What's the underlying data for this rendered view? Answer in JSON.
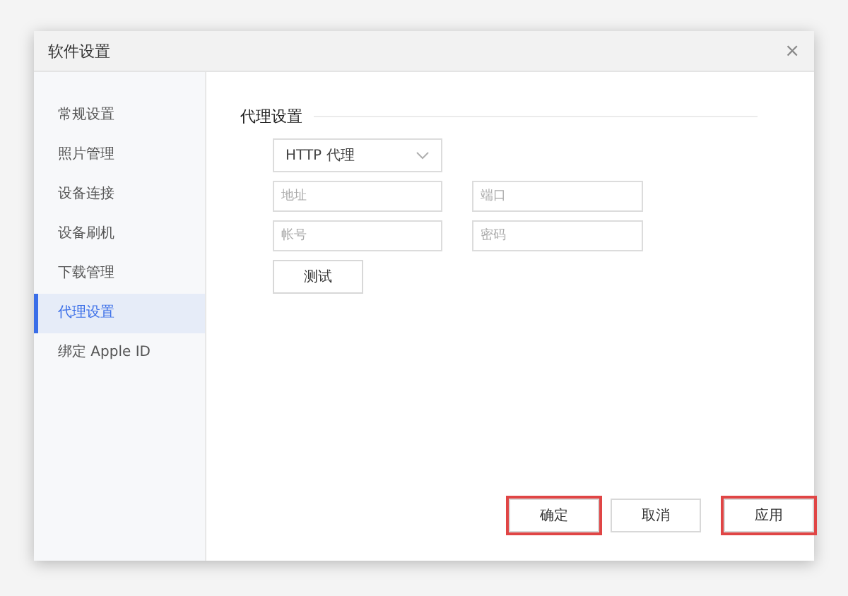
{
  "window": {
    "title": "软件设置",
    "close": "×"
  },
  "sidebar": {
    "items": [
      {
        "label": "常规设置",
        "selected": false
      },
      {
        "label": "照片管理",
        "selected": false
      },
      {
        "label": "设备连接",
        "selected": false
      },
      {
        "label": "设备刷机",
        "selected": false
      },
      {
        "label": "下载管理",
        "selected": false
      },
      {
        "label": "代理设置",
        "selected": true
      },
      {
        "label": "绑定 Apple ID",
        "selected": false
      }
    ]
  },
  "section": {
    "title": "代理设置"
  },
  "proxy_type": {
    "value": "HTTP 代理"
  },
  "fields": [
    {
      "placeholder": "地址"
    },
    {
      "placeholder": "端口"
    },
    {
      "placeholder": "帐号"
    },
    {
      "placeholder": "密码"
    }
  ],
  "test_button": "测试",
  "footer_buttons": [
    {
      "label": "确定",
      "highlighted": true
    },
    {
      "label": "取消",
      "highlighted": false
    },
    {
      "label": "应用",
      "highlighted": true
    }
  ]
}
